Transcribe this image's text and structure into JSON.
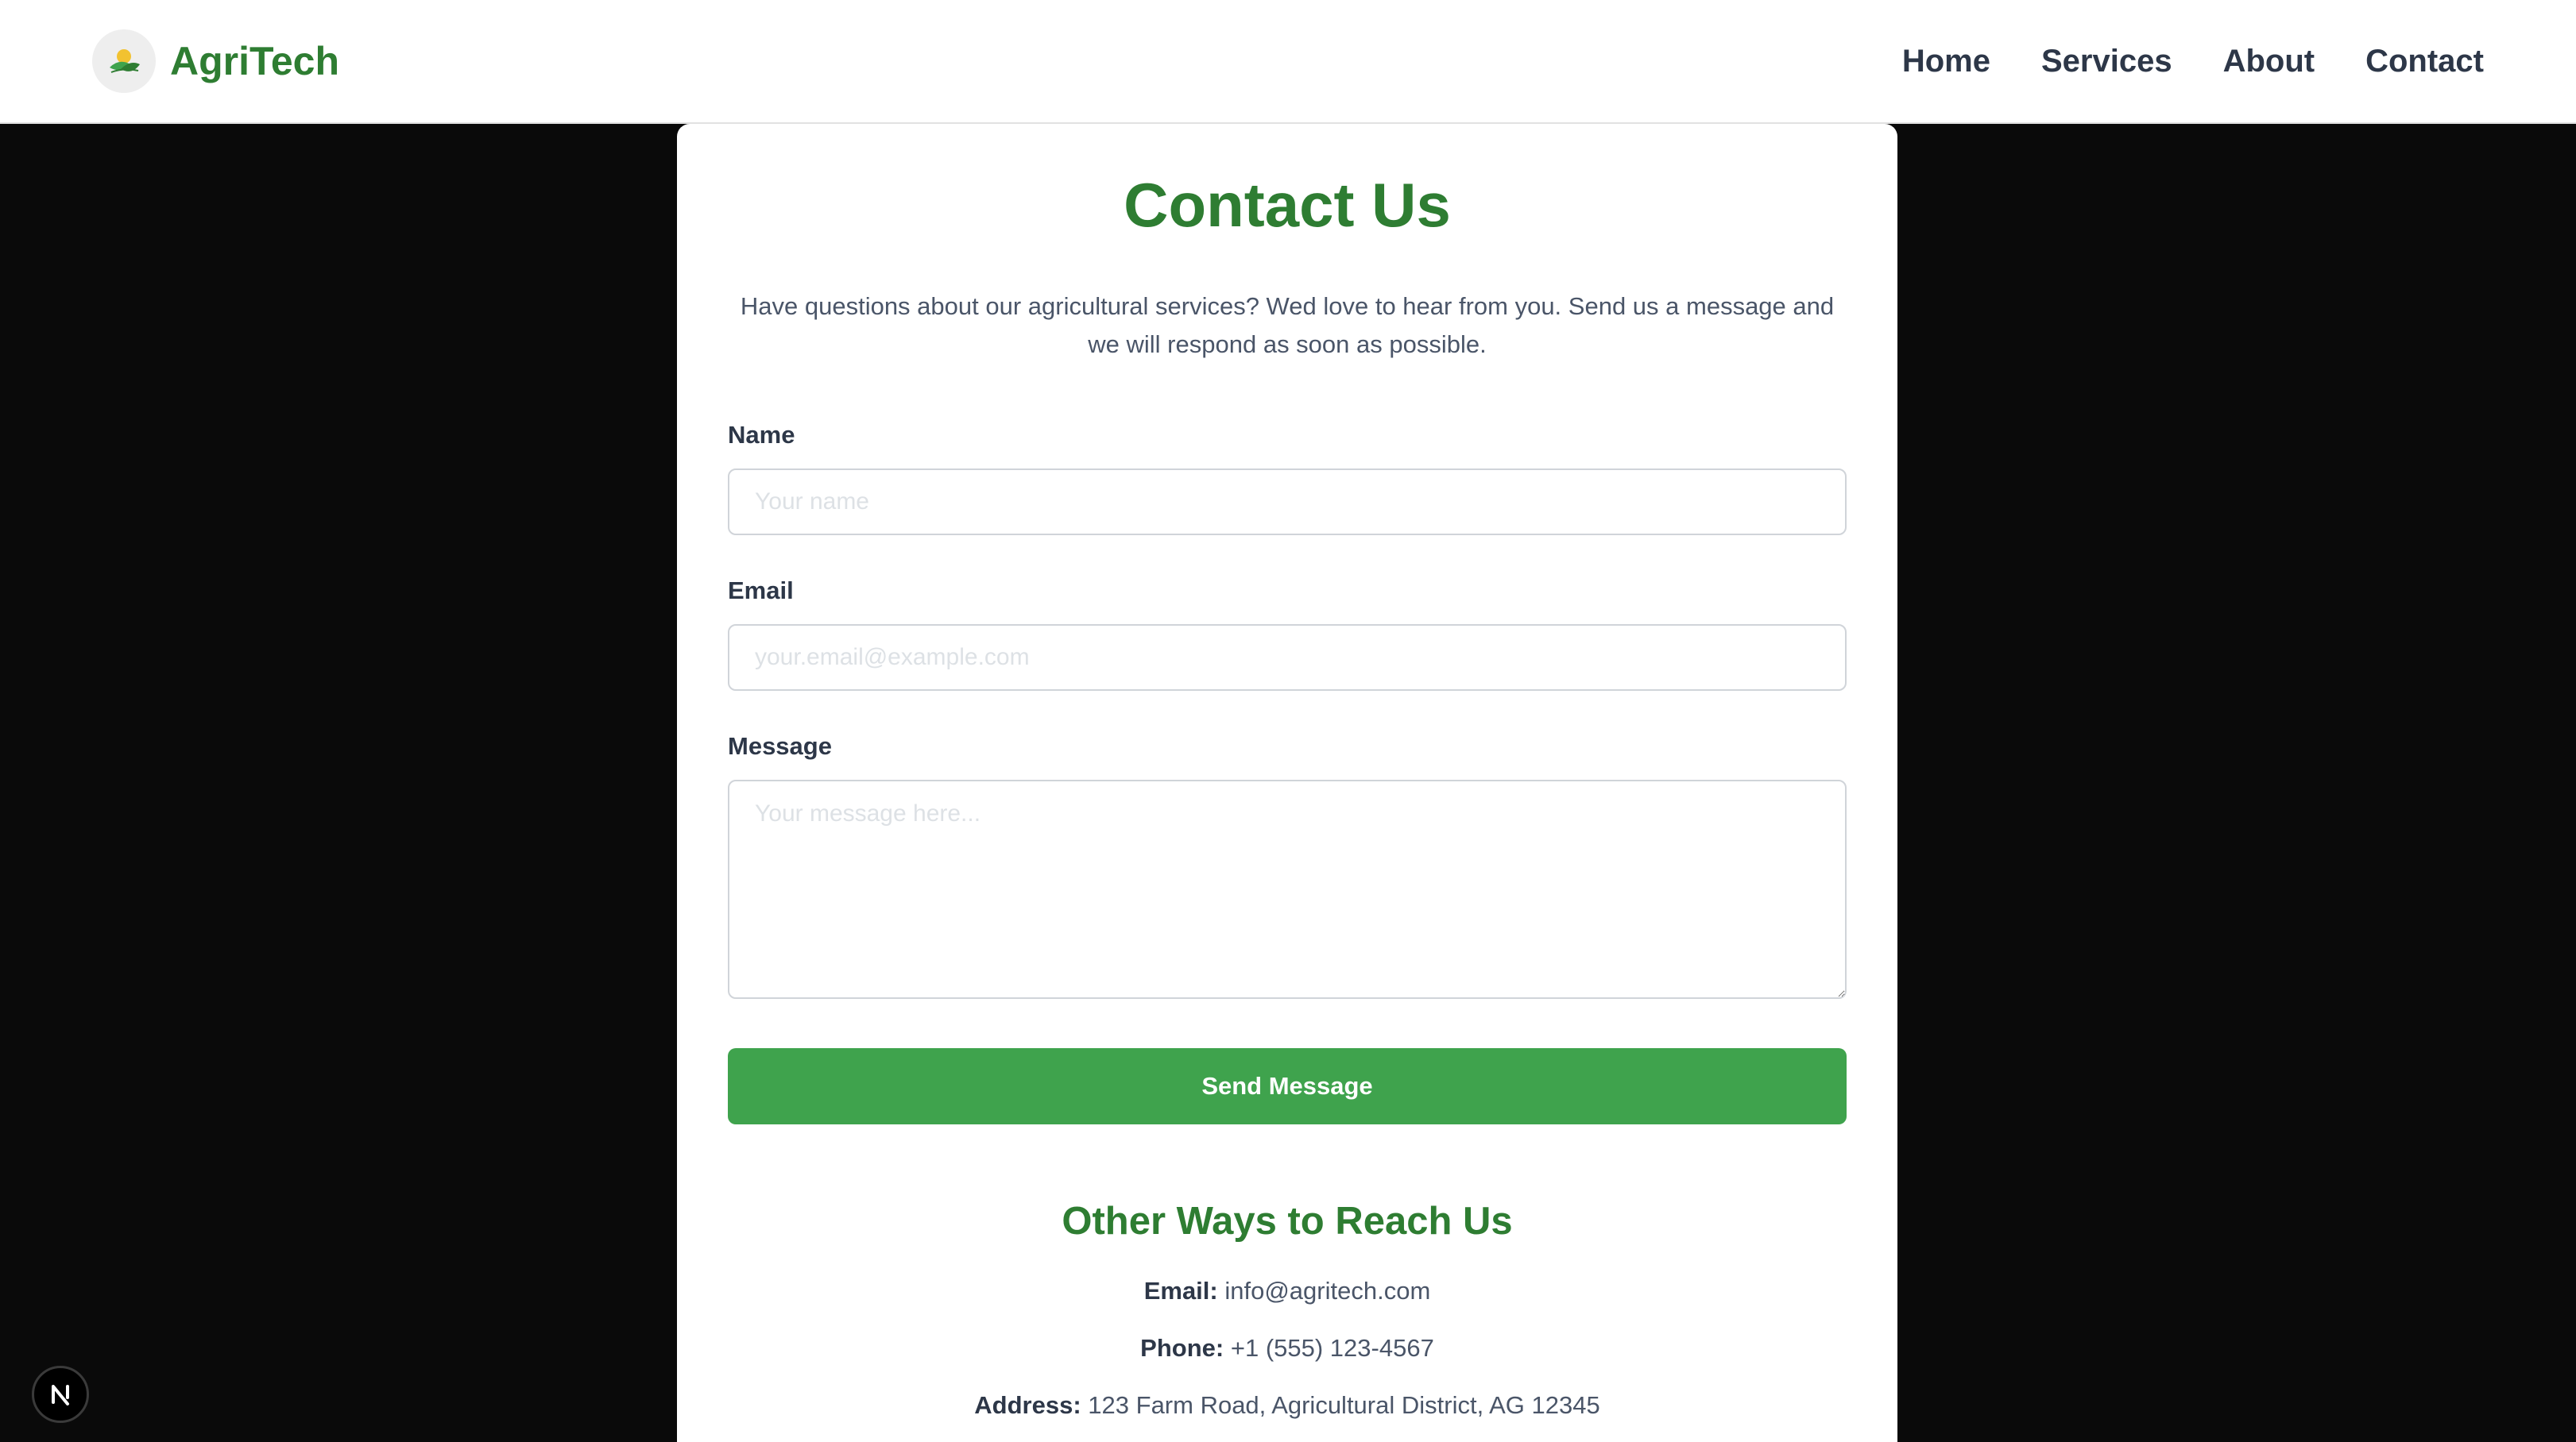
{
  "navbar": {
    "brand": "AgriTech",
    "logo_icon": "leaf-sun-logo-icon",
    "links": [
      "Home",
      "Services",
      "About",
      "Contact"
    ]
  },
  "contact": {
    "title": "Contact Us",
    "intro": "Have questions about our agricultural services? Wed love to hear from you. Send us a message and we will respond as soon as possible.",
    "form": {
      "name_label": "Name",
      "name_placeholder": "Your name",
      "name_value": "",
      "email_label": "Email",
      "email_placeholder": "your.email@example.com",
      "email_value": "",
      "message_label": "Message",
      "message_placeholder": "Your message here...",
      "message_value": "",
      "submit_label": "Send Message"
    },
    "other": {
      "title": "Other Ways to Reach Us",
      "email_label": "Email:",
      "email_value": "info@agritech.com",
      "phone_label": "Phone:",
      "phone_value": "+1 (555) 123-4567",
      "address_label": "Address:",
      "address_value": "123 Farm Road, Agricultural District, AG 12345"
    }
  },
  "dev_badge": {
    "letter": "N",
    "icon": "nextjs-dev-icon"
  },
  "colors": {
    "brand_green": "#2e7d32",
    "button_green": "#3fa34d",
    "page_background": "#0a0a0a",
    "text_dark": "#2d3748",
    "text_muted": "#4a5568"
  }
}
